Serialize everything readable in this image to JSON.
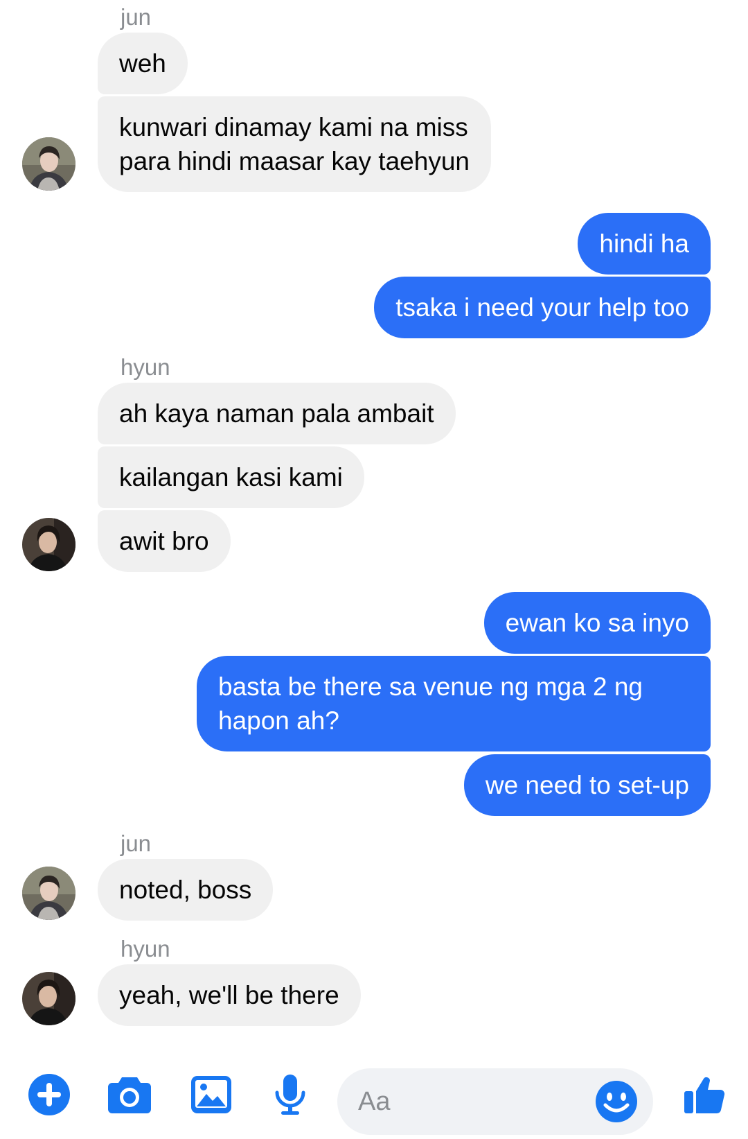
{
  "messages": {
    "m1_sender": "jun",
    "m1": "weh",
    "m2_line1": "kunwari dinamay kami na miss",
    "m2_line2": "para hindi maasar kay taehyun",
    "m3": "hindi ha",
    "m4": "tsaka i need your help too",
    "m5_sender": "hyun",
    "m5": "ah kaya naman pala ambait",
    "m6": "kailangan kasi kami",
    "m7": "awit bro",
    "m8": "ewan ko sa inyo",
    "m9_line1": "basta be there sa venue ng mga 2 ng",
    "m9_line2": "hapon ah?",
    "m10": "we need to set-up",
    "m11_sender": "jun",
    "m11": "noted, boss",
    "m12_sender": "hyun",
    "m12": "yeah, we'll be there"
  },
  "composer": {
    "placeholder": "Aa",
    "icons": [
      "plus-icon",
      "camera-icon",
      "image-icon",
      "microphone-icon",
      "emoji-icon",
      "thumbs-up-icon"
    ]
  },
  "colors": {
    "outgoing_bubble": "#2b6ff7",
    "incoming_bubble": "#f0f0f0",
    "accent": "#1877f2",
    "sender_text": "#8a8d91"
  }
}
